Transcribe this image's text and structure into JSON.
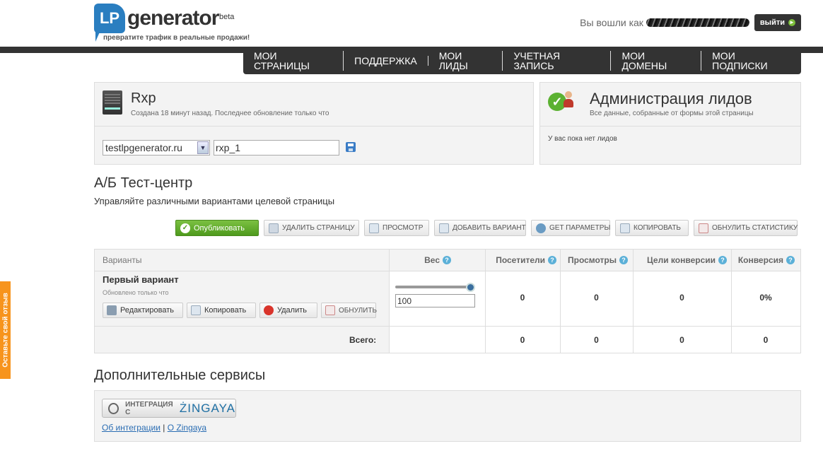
{
  "header": {
    "logo_lp": "LP",
    "logo_generator": "generator",
    "logo_beta": "beta",
    "logo_slogan": "превратите трафик в реальные продажи!",
    "login_text": "Вы вошли как",
    "logout_label": "выйти"
  },
  "nav": {
    "items": [
      "МОИ СТРАНИЦЫ",
      "ПОДДЕРЖКА",
      "МОИ ЛИДЫ",
      "УЧЕТНАЯ ЗАПИСЬ",
      "МОИ ДОМЕНЫ",
      "МОИ ПОДПИСКИ"
    ]
  },
  "page_panel": {
    "name": "Rxp",
    "subtitle": "Создана 18 минут назад. Последнее обновление только что",
    "domain_value": "testlpgenerator.ru",
    "slug_value": "rxp_1"
  },
  "leads_panel": {
    "title": "Администрация лидов",
    "subtitle": "Все данные, собранные от формы этой страницы",
    "empty_text": "У вас пока нет лидов"
  },
  "ab": {
    "title": "А/Б Тест-центр",
    "subtitle": "Управляйте различными вариантами целевой страницы"
  },
  "toolbar": {
    "publish": "Опубликовать",
    "delete_page": "УДАЛИТЬ СТРАНИЦУ",
    "preview": "ПРОСМОТР",
    "add_variant": "ДОБАВИТЬ ВАРИАНТ",
    "get_params": "GET ПАРАМЕТРЫ",
    "copy": "КОПИРОВАТЬ",
    "reset_stats": "ОБНУЛИТЬ СТАТИСТИКУ"
  },
  "variants": {
    "headers": {
      "variants": "Варианты",
      "weight": "Вес",
      "visitors": "Посетители",
      "views": "Просмотры",
      "goals": "Цели конверсии",
      "conversion": "Конверсия"
    },
    "row": {
      "name": "Первый вариант",
      "updated": "Обновлено только что",
      "edit": "Редактировать",
      "copy": "Копировать",
      "delete": "Удалить",
      "reset": "ОБНУЛИТЬ",
      "weight_value": "100",
      "weight_fraction": 1.0,
      "visitors": "0",
      "views": "0",
      "goals": "0",
      "conversion": "0%"
    },
    "total": {
      "label": "Всего:",
      "visitors": "0",
      "views": "0",
      "goals": "0",
      "conversion": "0"
    }
  },
  "extra": {
    "title": "Дополнительные сервисы",
    "integration_label": "ИНТЕГРАЦИЯ С",
    "zingaya_logo": "ŻINGAYA",
    "link_about_integration": "Об интеграции",
    "link_separator": "|",
    "link_about_zingaya": "О Zingaya"
  },
  "feedback": {
    "label": "Оставьте свой отзыв"
  }
}
